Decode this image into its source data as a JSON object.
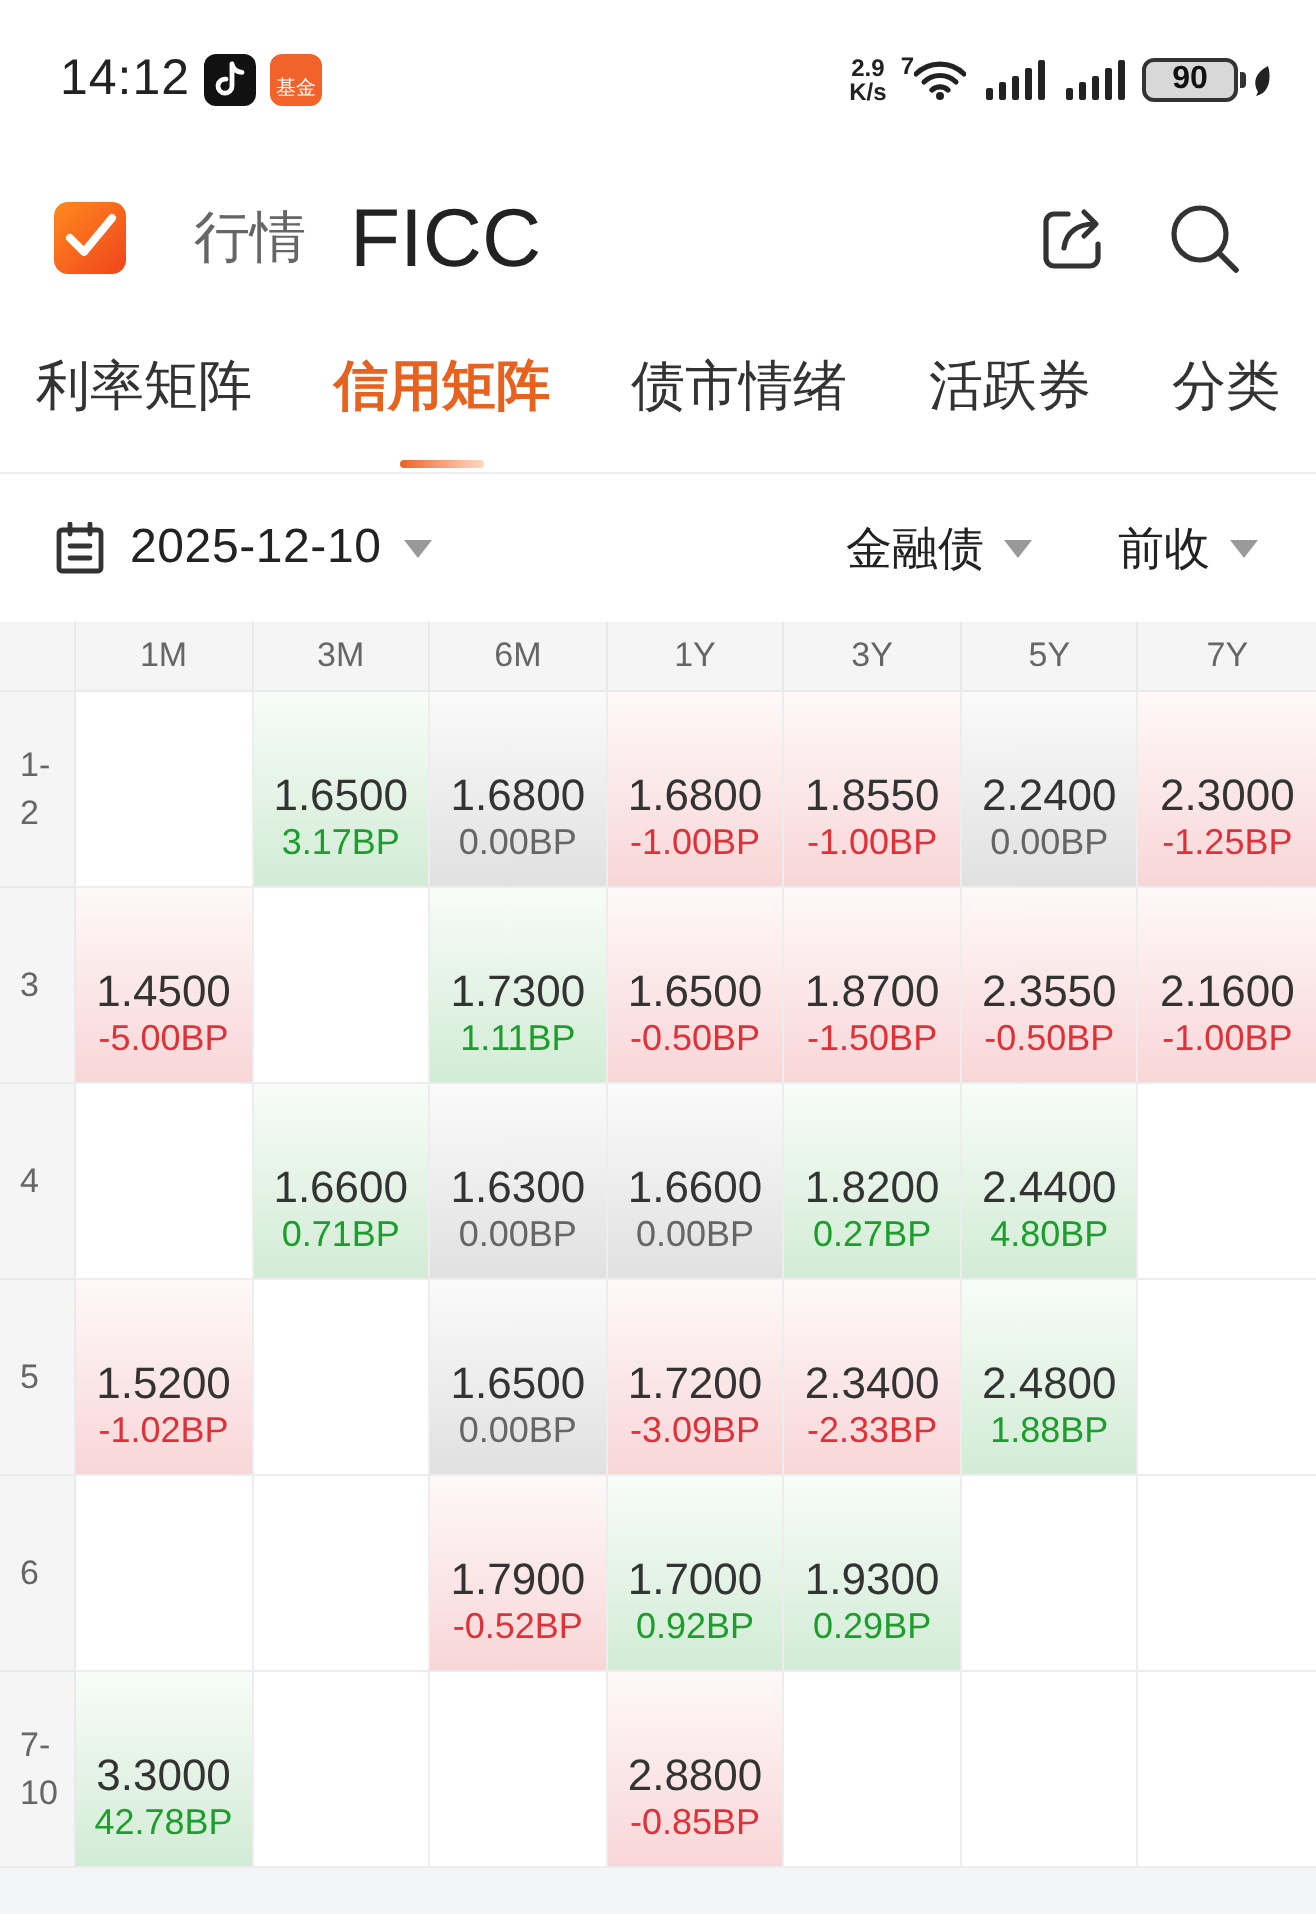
{
  "status_bar": {
    "time": "14:12",
    "app_badge": "基金",
    "net_speed": "2.9",
    "net_unit": "K/s",
    "wifi_label": "7",
    "battery": "90"
  },
  "header": {
    "section": "行情",
    "title": "FICC"
  },
  "tabs": [
    {
      "label": "利率矩阵",
      "selected": false
    },
    {
      "label": "信用矩阵",
      "selected": true
    },
    {
      "label": "债市情绪",
      "selected": false
    },
    {
      "label": "活跃券",
      "selected": false
    },
    {
      "label": "分类",
      "selected": false
    }
  ],
  "filters": {
    "date": "2025-12-10",
    "bond_type": "金融债",
    "price_basis": "前收"
  },
  "matrix": {
    "columns": [
      "1M",
      "3M",
      "6M",
      "1Y",
      "3Y",
      "5Y",
      "7Y"
    ],
    "rows": [
      {
        "label": "1-2",
        "cells": [
          null,
          {
            "value": "1.6500",
            "change": "3.17BP",
            "color": "#1c9e2c"
          },
          {
            "value": "1.6800",
            "change": "0.00BP",
            "color": "#666666"
          },
          {
            "value": "1.6800",
            "change": "-1.00BP",
            "color": "#df3138"
          },
          {
            "value": "1.8550",
            "change": "-1.00BP",
            "color": "#df3138"
          },
          {
            "value": "2.2400",
            "change": "0.00BP",
            "color": "#666666"
          },
          {
            "value": "2.3000",
            "change": "-1.25BP",
            "color": "#df3138"
          }
        ]
      },
      {
        "label": "3",
        "cells": [
          {
            "value": "1.4500",
            "change": "-5.00BP",
            "color": "#df3138"
          },
          null,
          {
            "value": "1.7300",
            "change": "1.11BP",
            "color": "#1c9e2c"
          },
          {
            "value": "1.6500",
            "change": "-0.50BP",
            "color": "#df3138"
          },
          {
            "value": "1.8700",
            "change": "-1.50BP",
            "color": "#df3138"
          },
          {
            "value": "2.3550",
            "change": "-0.50BP",
            "color": "#df3138"
          },
          {
            "value": "2.1600",
            "change": "-1.00BP",
            "color": "#df3138"
          }
        ]
      },
      {
        "label": "4",
        "cells": [
          null,
          {
            "value": "1.6600",
            "change": "0.71BP",
            "color": "#1c9e2c"
          },
          {
            "value": "1.6300",
            "change": "0.00BP",
            "color": "#666666"
          },
          {
            "value": "1.6600",
            "change": "0.00BP",
            "color": "#666666"
          },
          {
            "value": "1.8200",
            "change": "0.27BP",
            "color": "#1c9e2c"
          },
          {
            "value": "2.4400",
            "change": "4.80BP",
            "color": "#1c9e2c"
          },
          null
        ]
      },
      {
        "label": "5",
        "cells": [
          {
            "value": "1.5200",
            "change": "-1.02BP",
            "color": "#df3138"
          },
          null,
          {
            "value": "1.6500",
            "change": "0.00BP",
            "color": "#666666"
          },
          {
            "value": "1.7200",
            "change": "-3.09BP",
            "color": "#df3138"
          },
          {
            "value": "2.3400",
            "change": "-2.33BP",
            "color": "#df3138"
          },
          {
            "value": "2.4800",
            "change": "1.88BP",
            "color": "#1c9e2c"
          },
          null
        ]
      },
      {
        "label": "6",
        "cells": [
          null,
          null,
          {
            "value": "1.7900",
            "change": "-0.52BP",
            "color": "#df3138"
          },
          {
            "value": "1.7000",
            "change": "0.92BP",
            "color": "#1c9e2c"
          },
          {
            "value": "1.9300",
            "change": "0.29BP",
            "color": "#1c9e2c"
          },
          null,
          null
        ]
      },
      {
        "label": "7-10",
        "cells": [
          {
            "value": "3.3000",
            "change": "42.78BP",
            "color": "#1c9e2c"
          },
          null,
          null,
          {
            "value": "2.8800",
            "change": "-0.85BP",
            "color": "#df3138"
          },
          null,
          null,
          null
        ]
      }
    ]
  }
}
